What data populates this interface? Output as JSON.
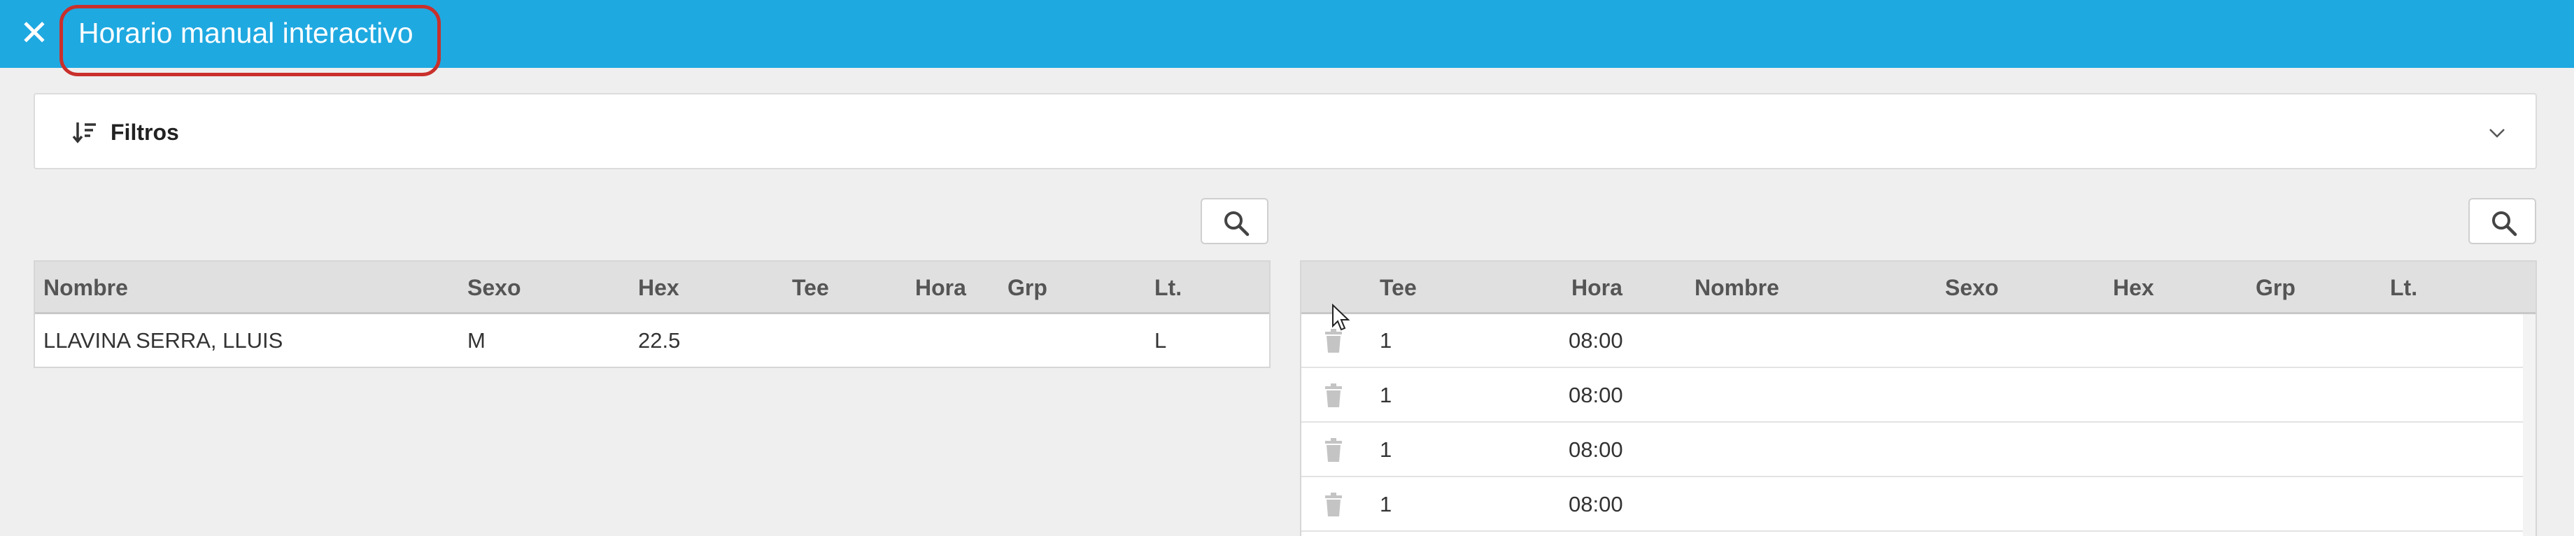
{
  "header": {
    "close_label": "✕",
    "title": "Horario manual interactivo"
  },
  "filters": {
    "label": "Filtros"
  },
  "left_table": {
    "columns": [
      "Nombre",
      "Sexo",
      "Hex",
      "Tee",
      "Hora",
      "Grp",
      "Lt."
    ],
    "rows": [
      {
        "nombre": "LLAVINA SERRA, LLUIS",
        "sexo": "M",
        "hex": "22.5",
        "tee": "",
        "hora": "",
        "grp": "",
        "lt": "L"
      }
    ]
  },
  "right_table": {
    "columns": [
      "Tee",
      "Hora",
      "Nombre",
      "Sexo",
      "Hex",
      "Grp",
      "Lt."
    ],
    "rows": [
      {
        "tee": "1",
        "hora": "08:00",
        "nombre": "",
        "sexo": "",
        "hex": "",
        "grp": "",
        "lt": ""
      },
      {
        "tee": "1",
        "hora": "08:00",
        "nombre": "",
        "sexo": "",
        "hex": "",
        "grp": "",
        "lt": ""
      },
      {
        "tee": "1",
        "hora": "08:00",
        "nombre": "",
        "sexo": "",
        "hex": "",
        "grp": "",
        "lt": ""
      },
      {
        "tee": "1",
        "hora": "08:00",
        "nombre": "",
        "sexo": "",
        "hex": "",
        "grp": "",
        "lt": ""
      }
    ]
  },
  "icons": {
    "close": "close-icon",
    "filters": "sort-filter-icon",
    "chevron": "chevron-down-icon",
    "search": "search-icon",
    "trash": "trash-icon"
  },
  "colors": {
    "header_bg": "#1fa9e1",
    "highlight": "#c9302c",
    "page_bg": "#efefef"
  }
}
